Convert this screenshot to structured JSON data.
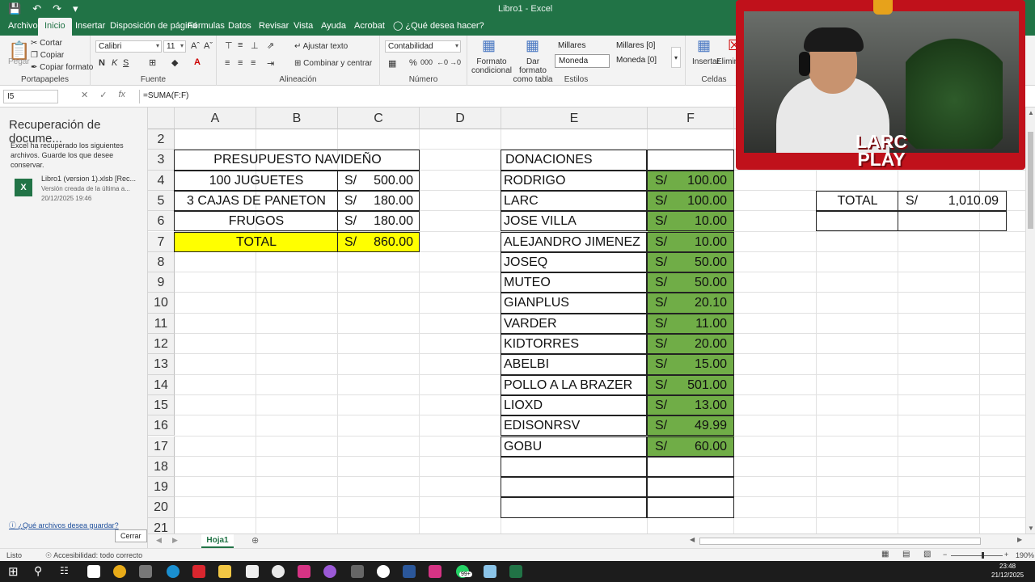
{
  "window": {
    "title": "Libro1  -  Excel"
  },
  "tabs": [
    "Archivo",
    "Inicio",
    "Insertar",
    "Disposición de página",
    "Fórmulas",
    "Datos",
    "Revisar",
    "Vista",
    "Ayuda",
    "Acrobat",
    "¿Qué desea hacer?"
  ],
  "ribbon": {
    "clipboard": {
      "paste": "Pegar",
      "cut": "Cortar",
      "copy": "Copiar",
      "format_painter": "Copiar formato",
      "label": "Portapapeles"
    },
    "font": {
      "name": "Calibri",
      "size": "11",
      "label": "Fuente",
      "bold": "N",
      "italic": "K",
      "underline": "S"
    },
    "alignment": {
      "wrap": "Ajustar texto",
      "merge": "Combinar y centrar",
      "label": "Alineación"
    },
    "number": {
      "format": "Contabilidad",
      "label": "Número"
    },
    "styles": {
      "cond": "Formato condicional",
      "table": "Dar formato como tabla",
      "s1": "Millares",
      "s2": "Millares [0]",
      "s3": "Moneda",
      "s4": "Moneda [0]",
      "label": "Estilos"
    },
    "cells": {
      "insert": "Insertar",
      "delete": "Eliminar",
      "label": "Celdas"
    }
  },
  "formula_bar": {
    "name_box": "I5",
    "formula": "=SUMA(F:F)"
  },
  "recovery": {
    "title": "Recuperación de docume...",
    "desc": "Excel ha recuperado los siguientes archivos. Guarde los que desee conservar.",
    "file_name": "Libro1 (version 1).xlsb  [Rec...",
    "file_version": "Versión creada de la última a...",
    "file_date": "20/12/2025 19:46",
    "link": "¿Qué archivos desea guardar?",
    "close": "Cerrar"
  },
  "columns": [
    "A",
    "B",
    "C",
    "D",
    "E",
    "F"
  ],
  "rows": [
    "2",
    "3",
    "4",
    "5",
    "6",
    "7",
    "8",
    "9",
    "10",
    "11",
    "12",
    "13",
    "14",
    "15",
    "16",
    "17",
    "18",
    "19",
    "20",
    "21"
  ],
  "budget": {
    "title": "PRESUPUESTO NAVIDEÑO",
    "items": [
      {
        "label": "100 JUGUETES",
        "cur": "S/",
        "amount": "500.00"
      },
      {
        "label": "3 CAJAS DE PANETON",
        "cur": "S/",
        "amount": "180.00"
      },
      {
        "label": "FRUGOS",
        "cur": "S/",
        "amount": "180.00"
      }
    ],
    "total": {
      "label": "TOTAL",
      "cur": "S/",
      "amount": "860.00"
    }
  },
  "donations": {
    "title": "DONACIONES",
    "items": [
      {
        "name": "RODRIGO",
        "cur": "S/",
        "amount": "100.00"
      },
      {
        "name": "LARC",
        "cur": "S/",
        "amount": "100.00"
      },
      {
        "name": "JOSE VILLA",
        "cur": "S/",
        "amount": "10.00"
      },
      {
        "name": "ALEJANDRO JIMENEZ",
        "cur": "S/",
        "amount": "10.00"
      },
      {
        "name": "JOSEQ",
        "cur": "S/",
        "amount": "50.00"
      },
      {
        "name": "MUTEO",
        "cur": "S/",
        "amount": "50.00"
      },
      {
        "name": "GIANPLUS",
        "cur": "S/",
        "amount": "20.10"
      },
      {
        "name": "VARDER",
        "cur": "S/",
        "amount": "11.00"
      },
      {
        "name": "KIDTORRES",
        "cur": "S/",
        "amount": "20.00"
      },
      {
        "name": "ABELBI",
        "cur": "S/",
        "amount": "15.00"
      },
      {
        "name": "POLLO A LA BRAZER",
        "cur": "S/",
        "amount": "501.00"
      },
      {
        "name": "LIOXD",
        "cur": "S/",
        "amount": "13.00"
      },
      {
        "name": "EDISONRSV",
        "cur": "S/",
        "amount": "49.99"
      },
      {
        "name": "GOBU",
        "cur": "S/",
        "amount": "60.00"
      }
    ]
  },
  "total_box": {
    "label": "TOTAL",
    "cur": "S/",
    "amount": "1,010.09"
  },
  "sheet_tab": "Hoja1",
  "status": {
    "ready": "Listo",
    "accessibility": "Accesibilidad: todo correcto",
    "zoom": "190%"
  },
  "taskbar": {
    "time": "23:48",
    "date": "21/12/2025",
    "badge": "99+"
  },
  "overlay": {
    "logo_line1": "LARC",
    "logo_line2": "PLAY"
  },
  "colors": {
    "excel_green": "#217346",
    "cell_yellow": "#ffff00",
    "cell_green": "#70ad47",
    "frame_red": "#c0111b"
  }
}
